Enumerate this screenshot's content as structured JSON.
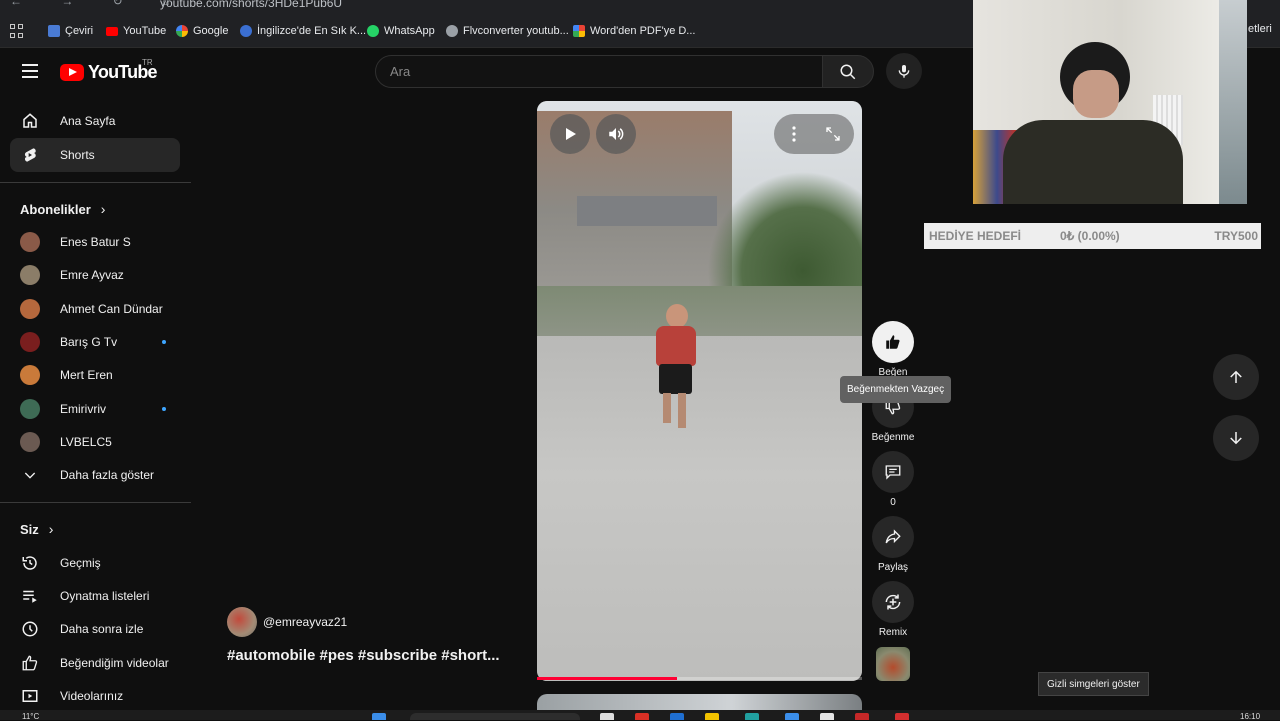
{
  "browser": {
    "url": "youtube.com/shorts/3HDe1Pub6U",
    "bookmarks": [
      "Çeviri",
      "YouTube",
      "Google",
      "İngilizce'de En Sık K...",
      "WhatsApp",
      "Flvconverter youtub...",
      "Word'den PDF'ye D..."
    ],
    "bookmark_overflow": "etleri"
  },
  "header": {
    "logo_text": "YouTube",
    "country_code": "TR",
    "search_placeholder": "Ara"
  },
  "sidebar": {
    "primary": [
      {
        "label": "Ana Sayfa",
        "icon": "home-icon",
        "active": false
      },
      {
        "label": "Shorts",
        "icon": "shorts-icon",
        "active": true
      }
    ],
    "subscriptions_title": "Abonelikler",
    "subscriptions": [
      {
        "label": "Enes Batur S",
        "new": false,
        "color": "#8a5a48"
      },
      {
        "label": "Emre Ayvaz",
        "new": false,
        "color": "#8b7d68"
      },
      {
        "label": "Ahmet Can Dündar",
        "new": false,
        "color": "#b5683d"
      },
      {
        "label": "Barış G Tv",
        "new": true,
        "color": "#7a1e1e"
      },
      {
        "label": "Mert Eren",
        "new": false,
        "color": "#c97a3a"
      },
      {
        "label": "Emirivriv",
        "new": true,
        "color": "#3e6b55"
      },
      {
        "label": "LVBELC5",
        "new": false,
        "color": "#6b5a52"
      }
    ],
    "show_more": "Daha fazla göster",
    "you_title": "Siz",
    "you_items": [
      {
        "label": "Geçmiş",
        "icon": "history-icon"
      },
      {
        "label": "Oynatma listeleri",
        "icon": "playlists-icon"
      },
      {
        "label": "Daha sonra izle",
        "icon": "watch-later-icon"
      },
      {
        "label": "Beğendiğim videolar",
        "icon": "liked-icon"
      },
      {
        "label": "Videolarınız",
        "icon": "your-videos-icon"
      }
    ]
  },
  "short": {
    "channel": "@emreayvaz21",
    "title": "#automobile #pes #subscribe #short...",
    "progress": 0.43
  },
  "actions": {
    "like_label": "Beğen",
    "like_tooltip": "Beğenmekten Vazgeç",
    "dislike_label": "Beğenme",
    "comments_count": "0",
    "share_label": "Paylaş",
    "remix_label": "Remix"
  },
  "overlay": {
    "goal_label": "HEDİYE HEDEFİ",
    "goal_progress": "0₺ (0.00%)",
    "goal_target": "TRY500"
  },
  "os": {
    "tray_tooltip": "Gizli simgeleri göster",
    "weather": "11°C",
    "clock": "16:10"
  }
}
